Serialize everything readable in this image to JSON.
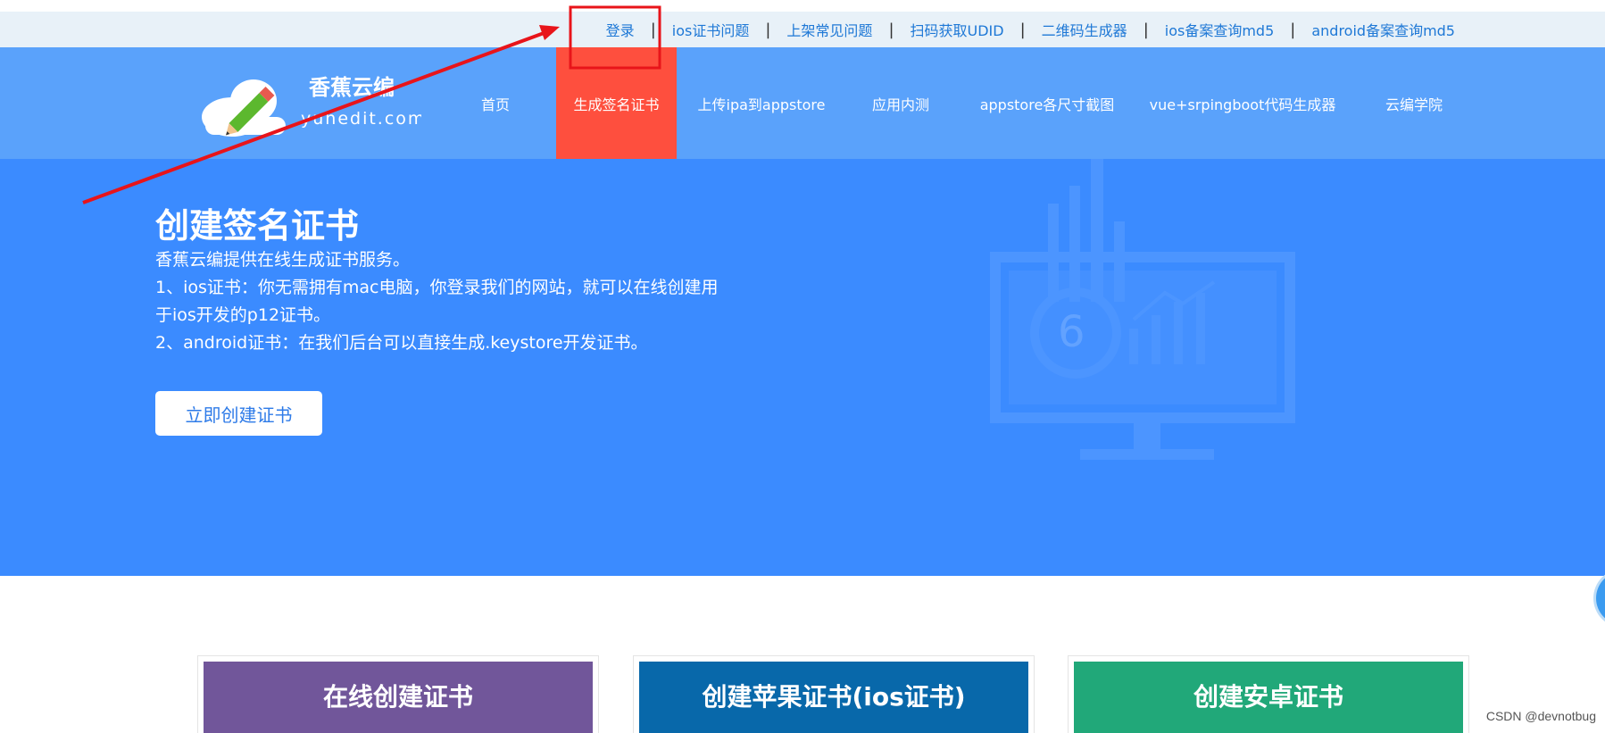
{
  "topbar": {
    "links": [
      "登录",
      "ios证书问题",
      "上架常见问题",
      "扫码获取UDID",
      "二维码生成器",
      "ios备案查询md5",
      "android备案查询md5"
    ],
    "separator": "|"
  },
  "logo": {
    "name": "香蕉云编",
    "domain_text": "yunedit.com"
  },
  "nav": {
    "items": [
      "首页",
      "生成签名证书",
      "上传ipa到appstore",
      "应用内测",
      "appstore各尺寸截图",
      "vue+srpingboot代码生成器",
      "云编学院"
    ],
    "active_index": 1
  },
  "hero": {
    "title": "创建签名证书",
    "lines": [
      "香蕉云编提供在线生成证书服务。",
      "1、ios证书：你无需拥有mac电脑，你登录我们的网站，就可以在线创建用于ios开发的p12证书。",
      "2、android证书：在我们后台可以直接生成.keystore开发证书。"
    ],
    "button_label": "立即创建证书",
    "deco_number": "6"
  },
  "cards": [
    {
      "title": "在线创建证书",
      "color": "#71569a"
    },
    {
      "title": "创建苹果证书(ios证书)",
      "color": "#0868aa"
    },
    {
      "title": "创建安卓证书",
      "color": "#21a879"
    }
  ],
  "watermark": "CSDN @devnotbug",
  "colors": {
    "topbar_bg": "#e8f1f8",
    "nav_bg": "#5aa2fb",
    "nav_active": "#fe4f3e",
    "hero_bg": "#3b8bff",
    "link": "#1e78d6",
    "annotation": "#e8141a"
  }
}
